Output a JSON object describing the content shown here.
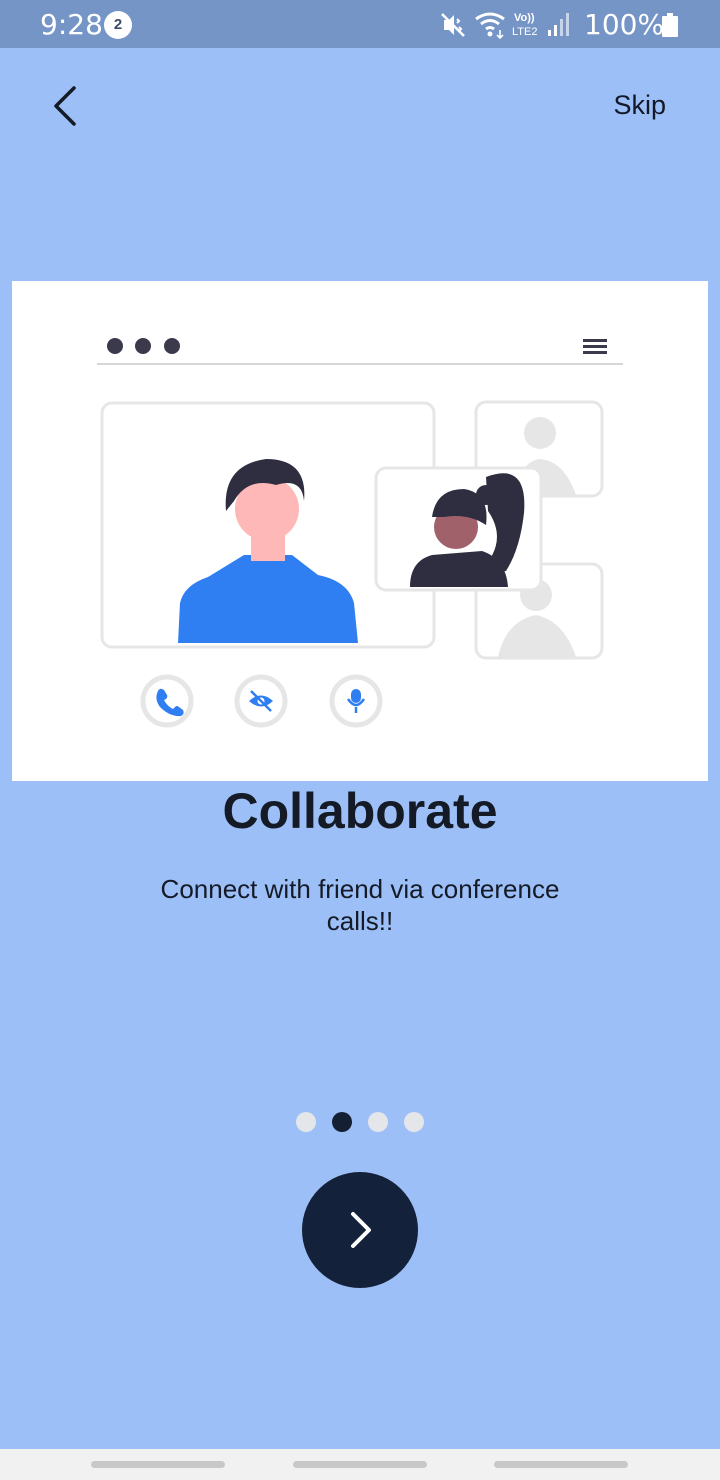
{
  "status_bar": {
    "time": "9:28",
    "notification_count": "2",
    "battery_text": "100%",
    "icons": [
      "mute-icon",
      "wifi-icon",
      "volte-lte2-icon",
      "signal-icon",
      "battery-icon"
    ]
  },
  "header": {
    "back_icon": "chevron-left-icon",
    "skip_label": "Skip"
  },
  "onboarding": {
    "title": "Collaborate",
    "description": "Connect with friend via conference calls!!",
    "page_count": 4,
    "current_page": 2,
    "next_icon": "chevron-right-icon"
  },
  "colors": {
    "background": "#9dbff7",
    "status_bar": "#7595c7",
    "accent": "#2f7ff2",
    "dark": "#141f33",
    "dot_inactive": "#e4e6ea"
  }
}
